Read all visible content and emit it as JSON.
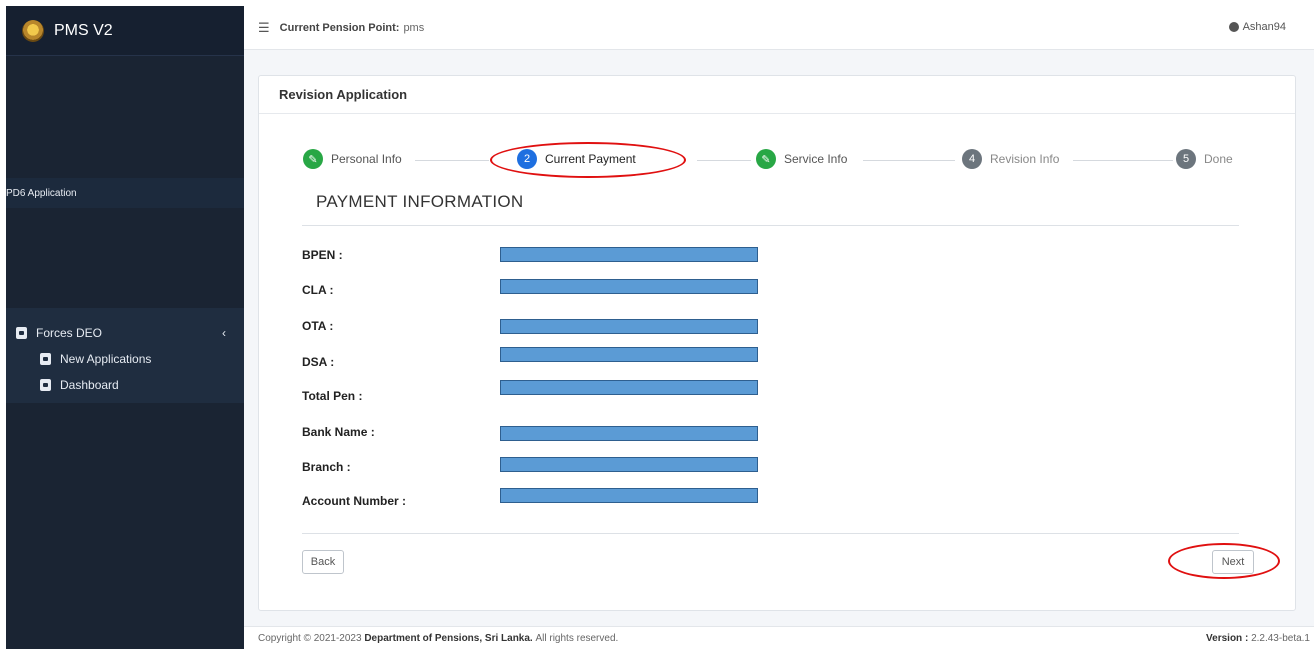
{
  "app": {
    "title": "PMS V2"
  },
  "sidebar": {
    "section_label": "PD6 Application",
    "group": {
      "label": "Forces DEO",
      "items": [
        {
          "label": "New Applications",
          "icon": "id-card-icon"
        },
        {
          "label": "Dashboard",
          "icon": "id-card-icon"
        }
      ]
    }
  },
  "topbar": {
    "pension_point_label": "Current Pension Point:",
    "pension_point_value": "pms",
    "user": "Ashan94"
  },
  "card": {
    "title": "Revision Application",
    "steps": [
      {
        "num": "1",
        "label": "Personal Info",
        "state": "done"
      },
      {
        "num": "2",
        "label": "Current Payment",
        "state": "active"
      },
      {
        "num": "3",
        "label": "Service Info",
        "state": "done"
      },
      {
        "num": "4",
        "label": "Revision Info",
        "state": "todo"
      },
      {
        "num": "5",
        "label": "Done",
        "state": "todo"
      }
    ],
    "section_title": "PAYMENT INFORMATION",
    "fields": [
      {
        "label": "BPEN :"
      },
      {
        "label": "CLA :"
      },
      {
        "label": "OTA :"
      },
      {
        "label": "DSA :"
      },
      {
        "label": "Total Pen :"
      },
      {
        "label": "Bank Name :"
      },
      {
        "label": "Branch :"
      },
      {
        "label": "Account Number :"
      }
    ],
    "back_label": "Back",
    "next_label": "Next"
  },
  "footer": {
    "copyright_prefix": "Copyright © 2021-2023",
    "org": "Department of Pensions, Sri Lanka.",
    "rights": "All rights reserved.",
    "version_label": "Version :",
    "version_value": "2.2.43-beta.1"
  },
  "colors": {
    "sidebar_bg": "#1a2433",
    "step_done": "#28a745",
    "step_active": "#1e6fe0",
    "step_todo": "#6c757d",
    "redaction": "#5b9bd5",
    "annotation": "#e01010"
  }
}
